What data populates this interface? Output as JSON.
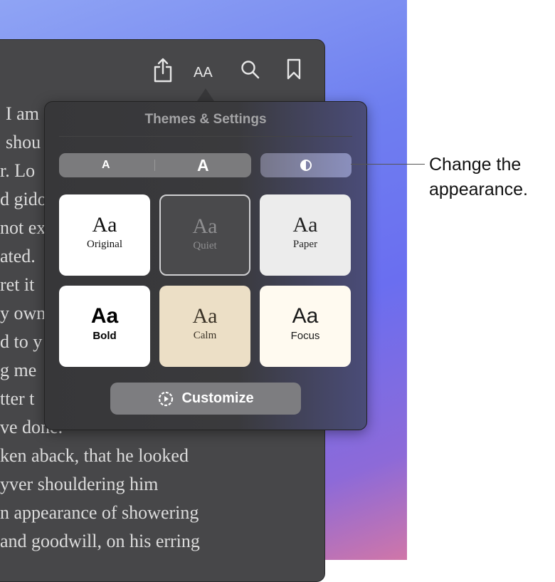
{
  "toolbar": {
    "icons": [
      "share-icon",
      "text-size-icon",
      "search-icon",
      "bookmark-icon"
    ],
    "text_size_label": "AA"
  },
  "book_lines": [
    "I am",
    "shou",
    "r. Lo",
    "d gido",
    "not ex",
    "ated.",
    "ret it",
    "y own",
    "d to y",
    "g me",
    "tter t",
    "ve done.",
    "ken aback, that he looked",
    "yver shouldering him",
    "n appearance of showering",
    "and goodwill, on his erring"
  ],
  "popover": {
    "title": "Themes & Settings",
    "font_smaller": "A",
    "font_larger": "A",
    "appearance_icon": "half-circle-icon",
    "themes": [
      {
        "sample": "Aa",
        "name": "Original",
        "bg": "#ffffff",
        "fg": "#111111"
      },
      {
        "sample": "Aa",
        "name": "Quiet",
        "bg": "#4a4a4c",
        "fg": "#8e8e90",
        "selected": true
      },
      {
        "sample": "Aa",
        "name": "Paper",
        "bg": "#ececec",
        "fg": "#222222"
      },
      {
        "sample": "Aa",
        "name": "Bold",
        "bg": "#ffffff",
        "fg": "#000000"
      },
      {
        "sample": "Aa",
        "name": "Calm",
        "bg": "#ecdfc6",
        "fg": "#3a3226"
      },
      {
        "sample": "Aa",
        "name": "Focus",
        "bg": "#fffaf0",
        "fg": "#1a1a1a"
      }
    ],
    "customize_label": "Customize"
  },
  "callout": {
    "line1": "Change the",
    "line2": "appearance."
  }
}
